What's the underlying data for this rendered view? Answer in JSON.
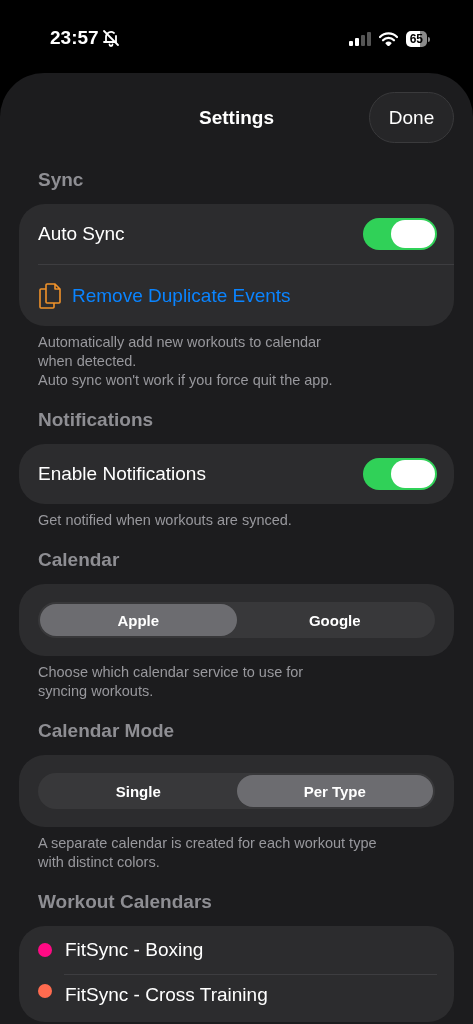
{
  "status_bar": {
    "time": "23:57",
    "battery": "65"
  },
  "nav": {
    "title": "Settings",
    "done": "Done"
  },
  "sections": [
    {
      "header": "Sync",
      "rows": [
        {
          "kind": "toggle",
          "label": "Auto Sync",
          "on": true
        },
        {
          "kind": "action",
          "label": "Remove Duplicate Events"
        }
      ],
      "footer": [
        "Automatically add new workouts to calendar",
        "when detected.",
        "Auto sync won't work if you force quit the app."
      ]
    },
    {
      "header": "Notifications",
      "rows": [
        {
          "kind": "toggle",
          "label": "Enable Notifications",
          "on": true
        }
      ],
      "footer": [
        "Get notified when workouts are synced."
      ]
    },
    {
      "header": "Calendar",
      "segments": [
        {
          "label": "Apple",
          "selected": true
        },
        {
          "label": "Google",
          "selected": false
        }
      ],
      "footer": [
        "Choose which calendar service to use for",
        "syncing workouts."
      ]
    },
    {
      "header": "Calendar Mode",
      "segments": [
        {
          "label": "Single",
          "selected": false
        },
        {
          "label": "Per Type",
          "selected": true
        }
      ],
      "footer": [
        "A separate calendar is created for each workout type",
        "with distinct colors."
      ]
    },
    {
      "header": "Workout Calendars",
      "rows": [
        {
          "kind": "calendar",
          "label": "FitSync - Boxing",
          "color": "#ff0a84"
        },
        {
          "kind": "calendar",
          "label": "FitSync - Cross Training",
          "color": "#ff6b4f"
        }
      ]
    }
  ]
}
